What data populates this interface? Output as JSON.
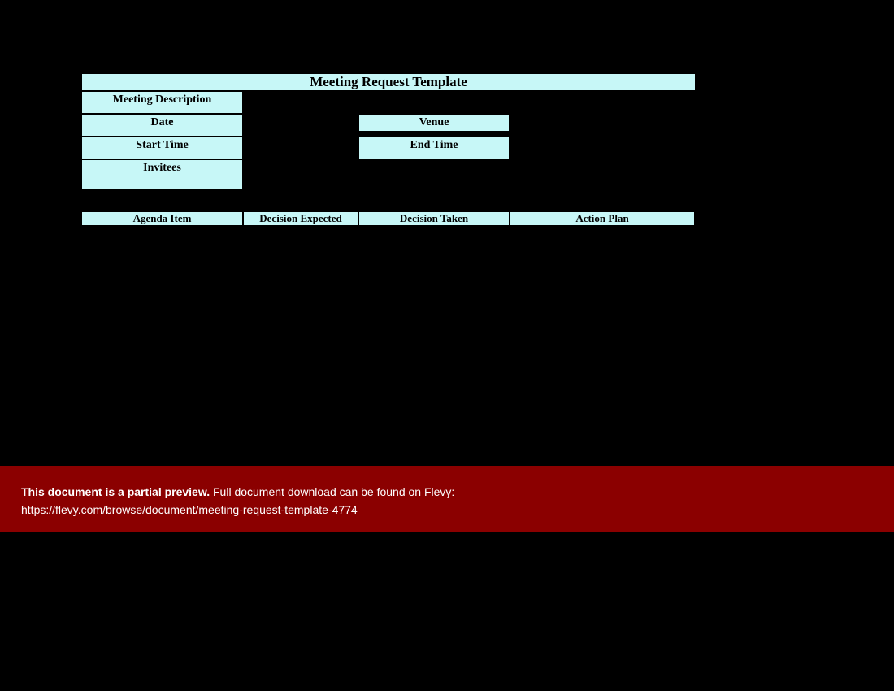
{
  "template": {
    "title": "Meeting Request Template",
    "fields": {
      "meetingDescription": "Meeting Description",
      "date": "Date",
      "venue": "Venue",
      "startTime": "Start Time",
      "endTime": "End Time",
      "invitees": "Invitees"
    },
    "columns": {
      "agendaItem": "Agenda Item",
      "decisionExpected": "Decision Expected",
      "decisionTaken": "Decision Taken",
      "actionPlan": "Action Plan"
    }
  },
  "banner": {
    "previewBold": "This document is a partial preview.",
    "previewRest": " Full document download can be found on Flevy:",
    "link": "https://flevy.com/browse/document/meeting-request-template-4774"
  }
}
